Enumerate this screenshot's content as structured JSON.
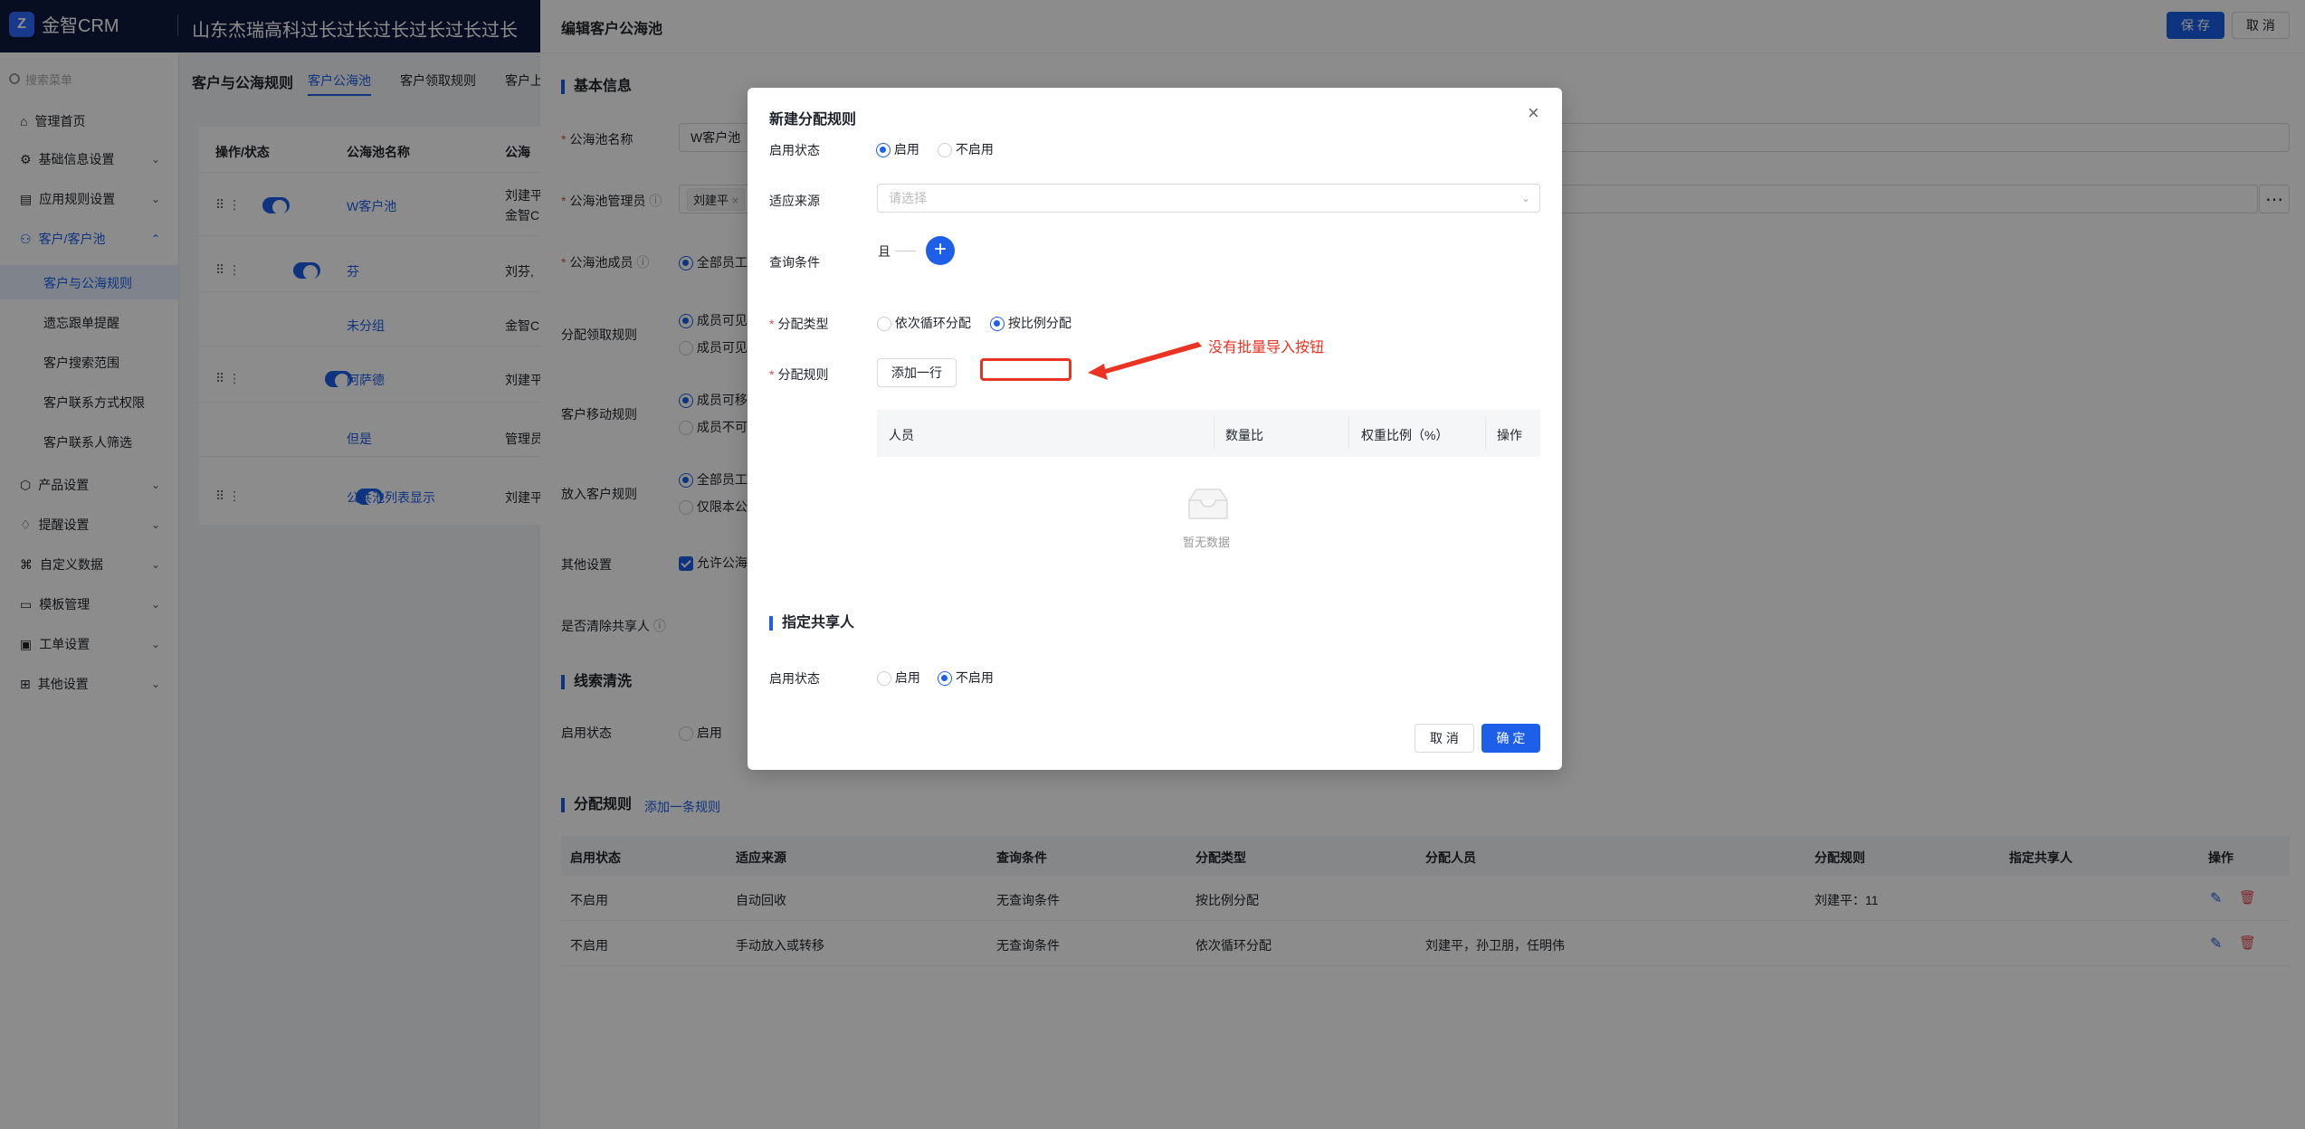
{
  "app": {
    "logo_text": "金智CRM",
    "company": "山东杰瑞高科过长过长过长过长过长过长"
  },
  "sidebar": {
    "search_placeholder": "搜索菜单",
    "items": [
      {
        "label": "管理首页"
      },
      {
        "label": "基础信息设置"
      },
      {
        "label": "应用规则设置"
      },
      {
        "label": "客户/客户池"
      },
      {
        "label": "产品设置"
      },
      {
        "label": "提醒设置"
      },
      {
        "label": "自定义数据"
      },
      {
        "label": "模板管理"
      },
      {
        "label": "工单设置"
      },
      {
        "label": "其他设置"
      }
    ],
    "subitems": [
      {
        "label": "客户与公海规则"
      },
      {
        "label": "遗忘跟单提醒"
      },
      {
        "label": "客户搜索范围"
      },
      {
        "label": "客户联系方式权限"
      },
      {
        "label": "客户联系人筛选"
      }
    ]
  },
  "mid": {
    "title": "客户与公海规则",
    "tabs": [
      "客户公海池",
      "客户领取规则",
      "客户上"
    ],
    "headers": [
      "操作/状态",
      "公海池名称",
      "公海"
    ],
    "rows": [
      {
        "name": "W客户池",
        "owner": "刘建平",
        "owner2": "金智C",
        "toggle": true
      },
      {
        "name": "芬",
        "owner": "刘芬,",
        "owner2": "",
        "toggle": true
      },
      {
        "name": "未分组",
        "owner": "金智C",
        "owner2": "",
        "toggle": null
      },
      {
        "name": "阿萨德",
        "owner": "刘建平",
        "owner2": "",
        "toggle": true
      },
      {
        "name": "但是",
        "owner": "管理员",
        "owner2": "",
        "toggle": null
      },
      {
        "name": "公共池列表显示",
        "owner": "刘建平",
        "owner2": "",
        "toggle": true
      }
    ]
  },
  "drawer": {
    "title": "编辑客户公海池",
    "save": "保 存",
    "cancel": "取 消",
    "basic": "基本信息",
    "pool_name_label": "公海池名称",
    "pool_name_value": "W客户池",
    "manager_label": "公海池管理员",
    "manager_tag": "刘建平",
    "more_icon": "⋯",
    "member_label": "公海池成员",
    "member_opt": "全部员工",
    "claim_label": "分配领取规则",
    "claim_opt1": "成员可见",
    "claim_opt2": "成员可见",
    "move_label": "客户移动规则",
    "move_opt1": "成员可移",
    "move_opt2": "成员不可",
    "putin_label": "放入客户规则",
    "putin_opt1": "全部员工",
    "putin_opt2": "仅限本公",
    "other_label": "其他设置",
    "other_opt": "允许公海",
    "clear_label": "是否清除共享人",
    "clue": "线索清洗",
    "clue_status_label": "启用状态",
    "clue_status_opt": "启用",
    "rules_title": "分配规则",
    "add_rule": "添加一条规则",
    "rules_headers": [
      "启用状态",
      "适应来源",
      "查询条件",
      "分配类型",
      "分配人员",
      "分配规则",
      "指定共享人",
      "操作"
    ],
    "rules_rows": [
      {
        "status": "不启用",
        "source": "自动回收",
        "cond": "无查询条件",
        "type": "按比例分配",
        "people": "",
        "rule": "刘建平：11",
        "share": ""
      },
      {
        "status": "不启用",
        "source": "手动放入或转移",
        "cond": "无查询条件",
        "type": "依次循环分配",
        "people": "刘建平，孙卫朋，任明伟",
        "rule": "",
        "share": ""
      }
    ]
  },
  "modal": {
    "title": "新建分配规则",
    "status_label": "启用状态",
    "enable": "启用",
    "disable": "不启用",
    "source_label": "适应来源",
    "source_placeholder": "请选择",
    "query_label": "查询条件",
    "query_and": "且",
    "type_label": "分配类型",
    "type_opt1": "依次循环分配",
    "type_opt2": "按比例分配",
    "rule_label": "分配规则",
    "add_row": "添加一行",
    "annotation": "没有批量导入按钮",
    "table_headers": [
      "人员",
      "数量比",
      "权重比例（%）",
      "操作"
    ],
    "empty": "暂无数据",
    "share_title": "指定共享人",
    "share_status_label": "启用状态",
    "cancel": "取 消",
    "ok": "确 定"
  },
  "colors": {
    "primary": "#1d5fe8",
    "danger": "#e5484d",
    "annotation": "#ea3323",
    "nav": "#0f1b3d"
  }
}
